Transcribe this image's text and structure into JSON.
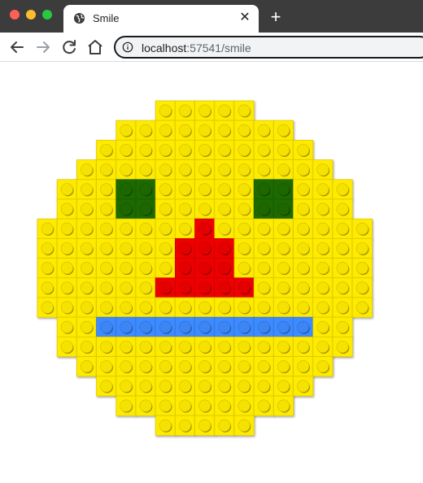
{
  "browser": {
    "tab": {
      "title": "Smile",
      "favicon": "globe-icon",
      "close_icon": "close-icon"
    },
    "new_tab_label": "+",
    "address": {
      "host": "localhost",
      "port_path": ":57541/smile",
      "icon": "info-icon"
    }
  },
  "colors": {
    "yellow": "#ffeb00",
    "green": "#1f6b00",
    "red": "#ee0000",
    "blue": "#3d8bff",
    "chrome_dark": "#3c3c3c"
  },
  "mosaic": {
    "palette": {
      "Y": "yellow",
      "G": "green",
      "R": "red",
      "B": "blue"
    },
    "rows": [
      "......YYYYY......",
      "....YYYYYYYYY....",
      "...YYYYYYYYYYY...",
      "..YYYYYYYYYYYYY..",
      ".YYYGGYYYYYGGYYY.",
      ".YYYGGYYYYYGGYYY.",
      "YYYYYYYYRYYYYYYYY",
      "YYYYYYYRRRYYYYYYY",
      "YYYYYYYRRRYYYYYYY",
      "YYYYYYRRRRRYYYYYY",
      "YYYYYYYYYYYYYYYYY",
      ".YYBBBBBBBBBBBYY.",
      ".YYYYYYYYYYYYYYY.",
      "..YYYYYYYYYYYYY..",
      "...YYYYYYYYYYY...",
      "....YYYYYYYYY....",
      "......YYYYY......"
    ]
  }
}
